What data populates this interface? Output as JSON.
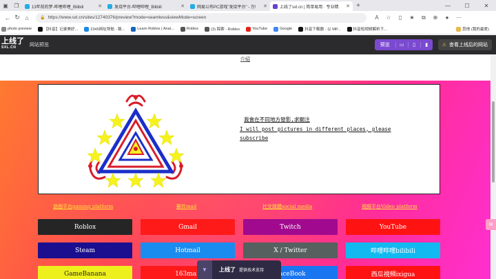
{
  "browser": {
    "tabs": [
      {
        "title": "13年前的梦-哔哩哔哩_Bilibili",
        "color": "#23ade5",
        "active": false
      },
      {
        "title": "发烧平台-哔哩哔哩_Bilibili",
        "color": "#23ade5",
        "active": false
      },
      {
        "title": "网易公布PC游戏\"发烧平台\" - 万!",
        "color": "#23ade5",
        "active": false
      },
      {
        "title": "上线了sxl.cn | 简单易用 · 专业精",
        "color": "#6a3fd1",
        "active": true
      }
    ],
    "url": "https://www.sxl.cn/sites/12740376/preview?mode=seamless&viewMode=screen",
    "bookmarks": [
      {
        "label": "photo preview",
        "color": "#888"
      },
      {
        "label": "【抖音】记录美好...",
        "color": "#111"
      },
      {
        "label": "2345网址导航 - 致...",
        "color": "#1e88e5"
      },
      {
        "label": "Learn Roblox | Anal...",
        "color": "#1565c0"
      },
      {
        "label": "Roblox",
        "color": "#555"
      },
      {
        "label": "(3) 探索 - Roblox",
        "color": "#555"
      },
      {
        "label": "YouTube",
        "color": "#e62117"
      },
      {
        "label": "Google",
        "color": "#4285f4"
      },
      {
        "label": "抖音下载器 - 以 MP...",
        "color": "#111"
      },
      {
        "label": "抖音短视频解析下...",
        "color": "#111"
      }
    ],
    "bookmarks_other": "其他 (我的最爱)"
  },
  "sitebar": {
    "logo_main": "上线了",
    "logo_sub": "SXL.CN",
    "label": "网站预览",
    "preview_label": "预览",
    "view_site_label": "查看上线后的网站"
  },
  "page": {
    "top_link": "介绍",
    "banner_text": {
      "line1": "我會在不同地方發影,求關注",
      "line2": "I will post pictures in different places, please",
      "line3": "subscribe"
    },
    "categories": [
      "遊戲平台gaming platform",
      "郵件mail",
      "社交媒體social media",
      "視頻平台Video platform"
    ],
    "buttons": [
      {
        "label": "Roblox",
        "color": "#252525"
      },
      {
        "label": "Gmail",
        "color": "#ff1a1a"
      },
      {
        "label": "Twitch",
        "color": "#a10a8e"
      },
      {
        "label": "YouTube",
        "color": "#ff1212"
      },
      {
        "label": "Steam",
        "color": "#1b0f8f"
      },
      {
        "label": "Hotmail",
        "color": "#1a8cf0"
      },
      {
        "label": "X / Twitter",
        "color": "#55605f"
      },
      {
        "label": "哔哩哔哩bilibili",
        "color": "#12b9f0"
      },
      {
        "label": "GameBanana",
        "color": "#eef01e"
      },
      {
        "label": "163mail",
        "color": "#ff1a1a"
      },
      {
        "label": "FaceBook",
        "color": "#1a76f0"
      },
      {
        "label": "西瓜視頻ixigua",
        "color": "#ff1212"
      }
    ],
    "support": {
      "logo": "上线了",
      "text": "提供技术支持"
    }
  },
  "colors": {
    "accent": "#7b4ad1",
    "emblem_blue": "#1a2fc9",
    "emblem_red": "#d81d2a",
    "emblem_yellow": "#f6f21d",
    "category_text": "#ffe23a"
  }
}
